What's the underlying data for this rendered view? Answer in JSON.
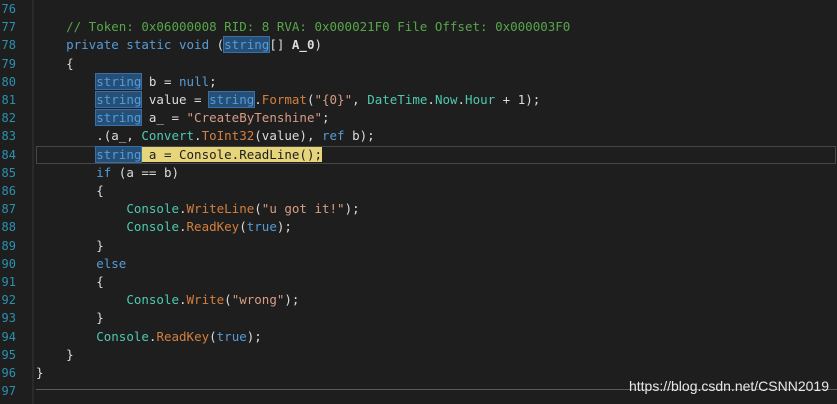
{
  "lines": [
    {
      "n": "76",
      "tokens": []
    },
    {
      "n": "77",
      "tokens": [
        {
          "t": "    // Token: 0x06000008 RID: 8 RVA: 0x000021F0 File Offset: 0x000003F0",
          "c": "cm"
        }
      ]
    },
    {
      "n": "78",
      "tokens": [
        {
          "t": "    private static void ",
          "c": "kw"
        },
        {
          "t": "(",
          "c": "id"
        },
        {
          "t": "string",
          "c": "hl"
        },
        {
          "t": "[] ",
          "c": "id"
        },
        {
          "t": "A_0",
          "c": "id bold"
        },
        {
          "t": ")",
          "c": "id"
        }
      ]
    },
    {
      "n": "79",
      "tokens": [
        {
          "t": "    {",
          "c": "id"
        }
      ]
    },
    {
      "n": "80",
      "tokens": [
        {
          "t": "        ",
          "c": "id"
        },
        {
          "t": "string",
          "c": "hl"
        },
        {
          "t": " b = ",
          "c": "id"
        },
        {
          "t": "null",
          "c": "kw"
        },
        {
          "t": ";",
          "c": "id"
        }
      ]
    },
    {
      "n": "81",
      "tokens": [
        {
          "t": "        ",
          "c": "id"
        },
        {
          "t": "string",
          "c": "hl"
        },
        {
          "t": " value = ",
          "c": "id"
        },
        {
          "t": "string",
          "c": "hl"
        },
        {
          "t": ".",
          "c": "id"
        },
        {
          "t": "Format",
          "c": "meth"
        },
        {
          "t": "(",
          "c": "id"
        },
        {
          "t": "\"{0}\"",
          "c": "str"
        },
        {
          "t": ", ",
          "c": "id"
        },
        {
          "t": "DateTime",
          "c": "typ"
        },
        {
          "t": ".",
          "c": "id"
        },
        {
          "t": "Now",
          "c": "typ"
        },
        {
          "t": ".",
          "c": "id"
        },
        {
          "t": "Hour",
          "c": "typ"
        },
        {
          "t": " + 1);",
          "c": "id"
        }
      ]
    },
    {
      "n": "82",
      "tokens": [
        {
          "t": "        ",
          "c": "id"
        },
        {
          "t": "string",
          "c": "hl"
        },
        {
          "t": " a_ = ",
          "c": "id"
        },
        {
          "t": "\"CreateByTenshine\"",
          "c": "str"
        },
        {
          "t": ";",
          "c": "id"
        }
      ]
    },
    {
      "n": "83",
      "tokens": [
        {
          "t": "        .(a_, ",
          "c": "id"
        },
        {
          "t": "Convert",
          "c": "typ"
        },
        {
          "t": ".",
          "c": "id"
        },
        {
          "t": "ToInt32",
          "c": "meth"
        },
        {
          "t": "(value), ",
          "c": "id"
        },
        {
          "t": "ref",
          "c": "kw"
        },
        {
          "t": " b);",
          "c": "id"
        }
      ]
    },
    {
      "n": "84",
      "current": true,
      "tokens": [
        {
          "t": "        ",
          "c": "id"
        },
        {
          "t": "string",
          "c": "hl"
        },
        {
          "t": " a = Console.ReadLine();",
          "c": "stmt-hl"
        }
      ]
    },
    {
      "n": "85",
      "tokens": [
        {
          "t": "        ",
          "c": "id"
        },
        {
          "t": "if",
          "c": "kw"
        },
        {
          "t": " (a == b)",
          "c": "id"
        }
      ]
    },
    {
      "n": "86",
      "tokens": [
        {
          "t": "        {",
          "c": "id"
        }
      ]
    },
    {
      "n": "87",
      "tokens": [
        {
          "t": "            ",
          "c": "id"
        },
        {
          "t": "Console",
          "c": "typ"
        },
        {
          "t": ".",
          "c": "id"
        },
        {
          "t": "WriteLine",
          "c": "meth"
        },
        {
          "t": "(",
          "c": "id"
        },
        {
          "t": "\"u got it!\"",
          "c": "str"
        },
        {
          "t": ");",
          "c": "id"
        }
      ]
    },
    {
      "n": "88",
      "tokens": [
        {
          "t": "            ",
          "c": "id"
        },
        {
          "t": "Console",
          "c": "typ"
        },
        {
          "t": ".",
          "c": "id"
        },
        {
          "t": "ReadKey",
          "c": "meth"
        },
        {
          "t": "(",
          "c": "id"
        },
        {
          "t": "true",
          "c": "kw"
        },
        {
          "t": ");",
          "c": "id"
        }
      ]
    },
    {
      "n": "89",
      "tokens": [
        {
          "t": "        }",
          "c": "id"
        }
      ]
    },
    {
      "n": "90",
      "tokens": [
        {
          "t": "        ",
          "c": "id"
        },
        {
          "t": "else",
          "c": "kw"
        }
      ]
    },
    {
      "n": "91",
      "tokens": [
        {
          "t": "        {",
          "c": "id"
        }
      ]
    },
    {
      "n": "92",
      "tokens": [
        {
          "t": "            ",
          "c": "id"
        },
        {
          "t": "Console",
          "c": "typ"
        },
        {
          "t": ".",
          "c": "id"
        },
        {
          "t": "Write",
          "c": "meth"
        },
        {
          "t": "(",
          "c": "id"
        },
        {
          "t": "\"wrong\"",
          "c": "str"
        },
        {
          "t": ");",
          "c": "id"
        }
      ]
    },
    {
      "n": "93",
      "tokens": [
        {
          "t": "        }",
          "c": "id"
        }
      ]
    },
    {
      "n": "94",
      "tokens": [
        {
          "t": "        ",
          "c": "id"
        },
        {
          "t": "Console",
          "c": "typ"
        },
        {
          "t": ".",
          "c": "id"
        },
        {
          "t": "ReadKey",
          "c": "meth"
        },
        {
          "t": "(",
          "c": "id"
        },
        {
          "t": "true",
          "c": "kw"
        },
        {
          "t": ");",
          "c": "id"
        }
      ]
    },
    {
      "n": "95",
      "tokens": [
        {
          "t": "    }",
          "c": "id"
        }
      ]
    },
    {
      "n": "96",
      "tokens": [
        {
          "t": "}",
          "c": "id"
        }
      ]
    },
    {
      "n": "97",
      "tokens": []
    }
  ],
  "watermark": "https://blog.csdn.net/CSNN2019",
  "colors": {
    "background": "#1e1e1e",
    "keyword": "#569cd6",
    "string": "#d69d85",
    "comment": "#57a64a",
    "method": "#d47f3e",
    "type": "#4ec9b0",
    "line_number": "#2b91af",
    "current_statement": "#e6d57a"
  }
}
